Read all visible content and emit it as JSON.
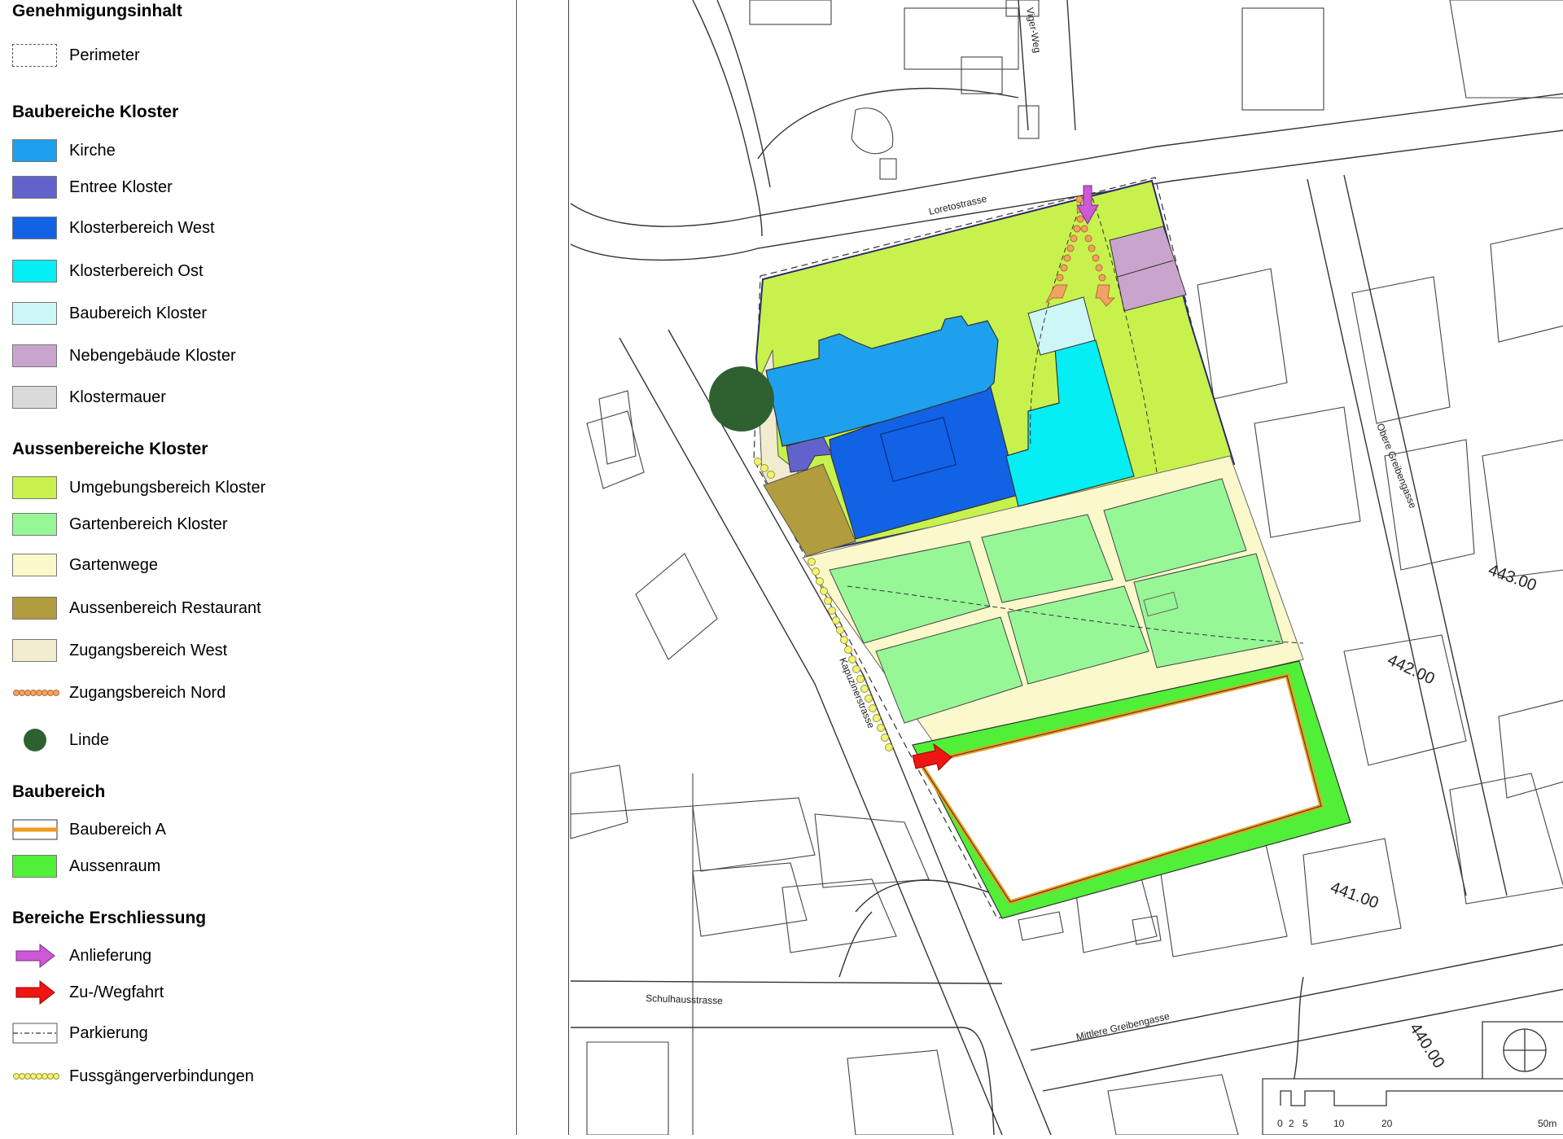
{
  "legend": {
    "title": "Genehmigungsinhalt",
    "perimeter": "Perimeter",
    "sections": {
      "kloster_bau": "Baubereiche Kloster",
      "kloster_aussen": "Aussenbereiche Kloster",
      "baubereich": "Baubereich",
      "erschliessung": "Bereiche Erschliessung"
    },
    "items": {
      "kirche": {
        "label": "Kirche",
        "color": "#1ea0ee"
      },
      "entree": {
        "label": "Entree Kloster",
        "color": "#6262cc"
      },
      "west": {
        "label": "Klosterbereich West",
        "color": "#1262e6"
      },
      "ost": {
        "label": "Klosterbereich Ost",
        "color": "#05eef3"
      },
      "baubereich_kloster": {
        "label": "Baubereich Kloster",
        "color": "#cdf7f7"
      },
      "neben": {
        "label": "Nebengebäude Kloster",
        "color": "#c9a5cd"
      },
      "mauer": {
        "label": "Klostermauer",
        "color": "#dadada"
      },
      "umgebung": {
        "label": "Umgebungsbereich Kloster",
        "color": "#c7f24e"
      },
      "garten": {
        "label": "Gartenbereich Kloster",
        "color": "#97f797"
      },
      "wege": {
        "label": "Gartenwege",
        "color": "#fbf8cc"
      },
      "restaurant": {
        "label": "Aussenbereich Restaurant",
        "color": "#b19c3e"
      },
      "zugang_west": {
        "label": "Zugangsbereich West",
        "color": "#f1ebcf"
      },
      "zugang_nord": {
        "label": "Zugangsbereich Nord",
        "color": "#f1a366"
      },
      "linde": {
        "label": "Linde",
        "color": "#2f6130"
      },
      "baubereich_a": {
        "label": "Baubereich A",
        "color": "#f19a1e"
      },
      "aussenraum": {
        "label": "Aussenraum",
        "color": "#52ef39"
      },
      "anlieferung": {
        "label": "Anlieferung",
        "color": "#cd58d8"
      },
      "wegfahrt": {
        "label": "Zu-/Wegfahrt",
        "color": "#ef1512"
      },
      "parkierung": {
        "label": "Parkierung"
      },
      "fussgaenger": {
        "label": "Fussgängerverbindungen",
        "color": "#f4f279"
      }
    }
  },
  "map": {
    "streets": {
      "loreto": "Loretostrasse",
      "kapuziner": "Kapuzinerstrasse",
      "schulhaus": "Schulhausstrasse",
      "mittlere": "Mittlere Greibengasse",
      "obere": "Obere Greibengasse",
      "viger": "Viger-Weg"
    },
    "elevations": [
      "443.00",
      "442.00",
      "441.00",
      "440.00"
    ],
    "scale_labels": [
      "0",
      "2",
      "5",
      "10",
      "20",
      "50m"
    ]
  }
}
